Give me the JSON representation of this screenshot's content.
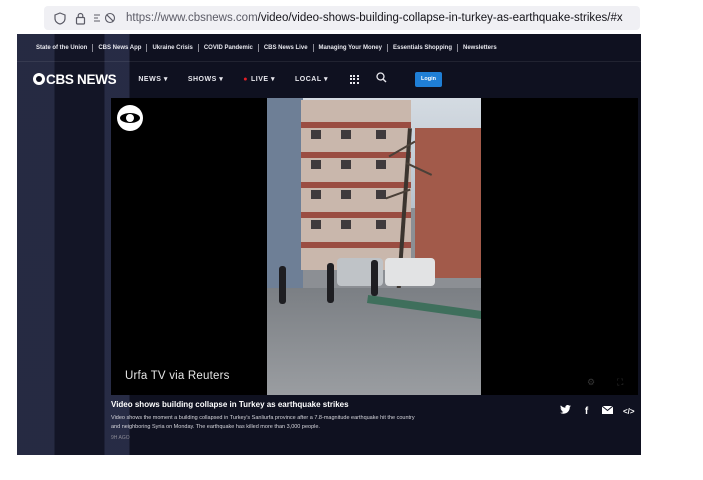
{
  "browser": {
    "url_host": "https://www.cbsnews.com",
    "url_path": "/video/video-shows-building-collapse-in-turkey-as-earthquake-strikes/#x"
  },
  "topnav": {
    "items": [
      "State of the Union",
      "CBS News App",
      "Ukraine Crisis",
      "COVID Pandemic",
      "CBS News Live",
      "Managing Your Money",
      "Essentials Shopping",
      "Newsletters"
    ]
  },
  "mainnav": {
    "logo": "CBS NEWS",
    "items": [
      "NEWS",
      "SHOWS",
      "LIVE",
      "LOCAL"
    ],
    "login_label": "Login"
  },
  "video": {
    "credit": "Urfa TV via Reuters"
  },
  "article": {
    "title": "Video shows building collapse in Turkey as earthquake strikes",
    "description": "Video shows the moment a building collapsed in Turkey's Sanliurfa province after a 7.8-magnitude earthquake hit the country and neighboring Syria on Monday. The earthquake has killed more than 3,000 people.",
    "age": "9H AGO"
  },
  "colors": {
    "accent": "#1f7fd6",
    "live_dot": "#e41e26",
    "background": "#0e1020"
  }
}
